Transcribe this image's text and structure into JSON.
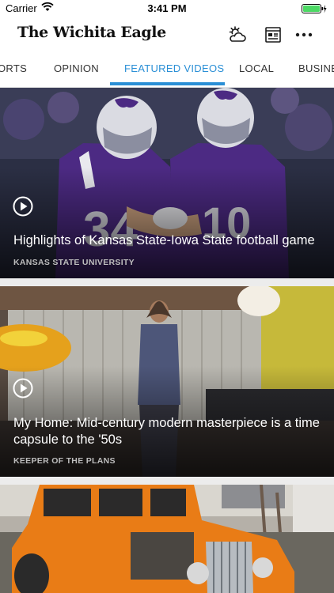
{
  "status_bar": {
    "carrier": "Carrier",
    "time": "3:41 PM"
  },
  "header": {
    "logo": "The Wichita Eagle",
    "icons": [
      "weather-icon",
      "newspaper-icon",
      "more-icon"
    ]
  },
  "tabs": [
    {
      "label": "ORTS"
    },
    {
      "label": "OPINION"
    },
    {
      "label": "FEATURED VIDEOS",
      "active": true
    },
    {
      "label": "LOCAL"
    },
    {
      "label": "BUSINES"
    }
  ],
  "videos": [
    {
      "title": "Highlights of Kansas State-Iowa State football game",
      "label": "KANSAS STATE UNIVERSITY"
    },
    {
      "title": "My Home: Mid-century modern masterpiece is a time capsule to the '50s",
      "label": "KEEPER OF THE PLANS"
    },
    {
      "title": "",
      "label": ""
    }
  ],
  "colors": {
    "accent": "#2a8fd6",
    "battery": "#4cd964"
  }
}
